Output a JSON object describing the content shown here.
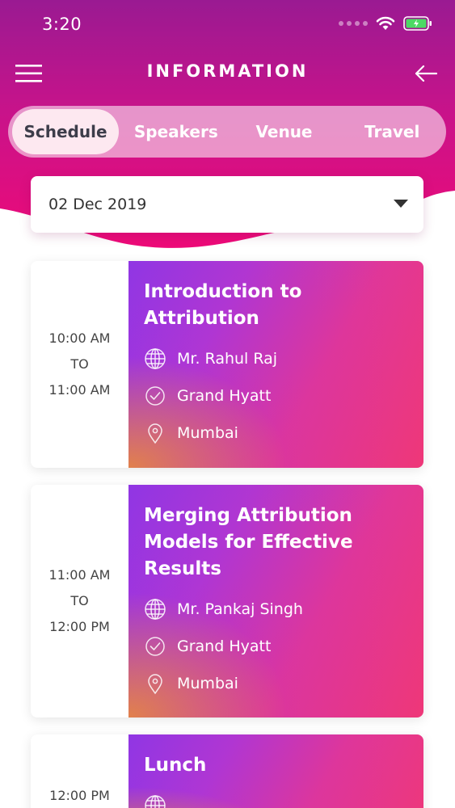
{
  "status": {
    "time": "3:20"
  },
  "nav": {
    "title": "INFORMATION"
  },
  "tabs": [
    {
      "label": "Schedule",
      "active": true
    },
    {
      "label": "Speakers",
      "active": false
    },
    {
      "label": "Venue",
      "active": false
    },
    {
      "label": "Travel",
      "active": false
    }
  ],
  "date_select": {
    "value": "02 Dec 2019"
  },
  "sessions": [
    {
      "start": "10:00 AM",
      "sep": "TO",
      "end": "11:00 AM",
      "title_lines": [
        "Introduction to",
        "Attribution"
      ],
      "speaker": "Mr. Rahul Raj",
      "venue": "Grand Hyatt",
      "city": "Mumbai"
    },
    {
      "start": "11:00 AM",
      "sep": "TO",
      "end": "12:00 PM",
      "title_lines": [
        "Merging Attribution",
        "Models for Effective",
        "Results"
      ],
      "speaker": "Mr. Pankaj Singh",
      "venue": "Grand Hyatt",
      "city": "Mumbai"
    },
    {
      "start": "12:00 PM",
      "title_lines": [
        "Lunch"
      ]
    }
  ],
  "colors": {
    "header_top": "#a0168f",
    "header_bottom": "#e8087a",
    "accent": "#d41e8a"
  }
}
